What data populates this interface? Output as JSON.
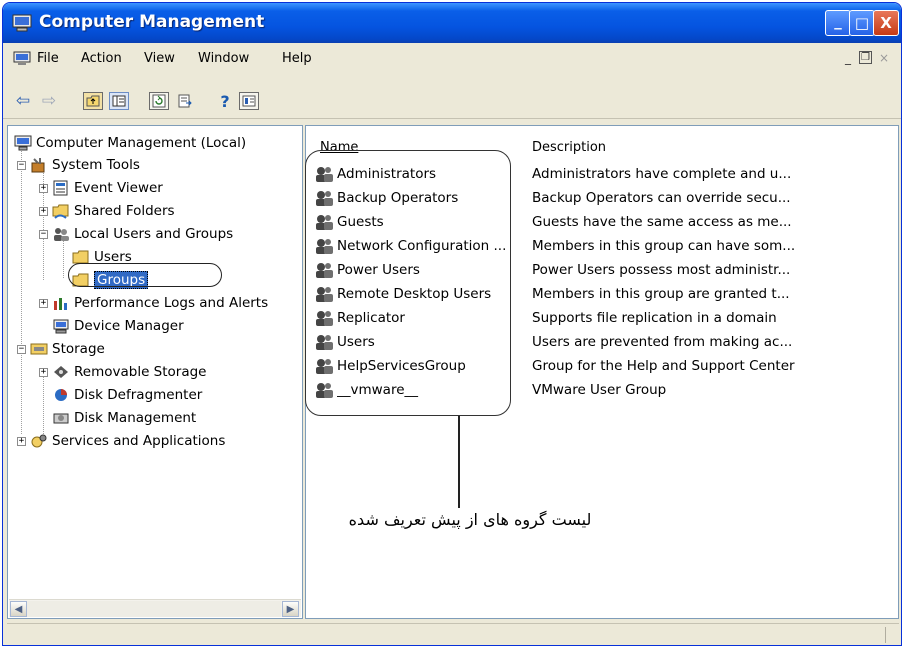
{
  "window": {
    "title": "Computer Management",
    "minimize_label": "_",
    "maximize_label": "□",
    "close_label": "X"
  },
  "menu": {
    "items": [
      "File",
      "Action",
      "View",
      "Window",
      "Help"
    ],
    "mdi_controls": "_ | ⧉ | ×"
  },
  "toolbar": {
    "buttons": [
      "back-icon",
      "forward-icon",
      "up-folder-icon",
      "show-hide-tree-icon",
      "refresh-icon",
      "export-list-icon",
      "help-icon",
      "properties-icon"
    ]
  },
  "tree": {
    "root": "Computer Management (Local)",
    "items": [
      {
        "label": "System Tools",
        "expanded": true
      },
      {
        "label": "Event Viewer",
        "expanded": false
      },
      {
        "label": "Shared Folders",
        "expanded": false
      },
      {
        "label": "Local Users and Groups",
        "expanded": true
      },
      {
        "label": "Users"
      },
      {
        "label": "Groups",
        "selected": true
      },
      {
        "label": "Performance Logs and Alerts",
        "expanded": false
      },
      {
        "label": "Device Manager"
      },
      {
        "label": "Storage",
        "expanded": true
      },
      {
        "label": "Removable Storage",
        "expanded": false
      },
      {
        "label": "Disk Defragmenter"
      },
      {
        "label": "Disk Management"
      },
      {
        "label": "Services and Applications",
        "expanded": false
      }
    ]
  },
  "list": {
    "columns": [
      "Name",
      "Description"
    ],
    "rows": [
      {
        "name": "Administrators",
        "description": "Administrators have complete and u..."
      },
      {
        "name": "Backup Operators",
        "description": "Backup Operators can override secu..."
      },
      {
        "name": "Guests",
        "description": "Guests have the same access as me..."
      },
      {
        "name": "Network Configuration ...",
        "description": "Members in this group can have som..."
      },
      {
        "name": "Power Users",
        "description": "Power Users possess most administr..."
      },
      {
        "name": "Remote Desktop Users",
        "description": "Members in this group are granted t..."
      },
      {
        "name": "Replicator",
        "description": "Supports file replication in a domain"
      },
      {
        "name": "Users",
        "description": "Users are prevented from making ac..."
      },
      {
        "name": "HelpServicesGroup",
        "description": "Group for the Help and Support Center"
      },
      {
        "name": "__vmware__",
        "description": "VMware User Group"
      }
    ]
  },
  "annotation": {
    "text": "لیست گروه های از پیش تعریف شده"
  },
  "colors": {
    "titlebar": "#0554e0",
    "selection": "#316ac5",
    "window_bg": "#ece9d8"
  }
}
